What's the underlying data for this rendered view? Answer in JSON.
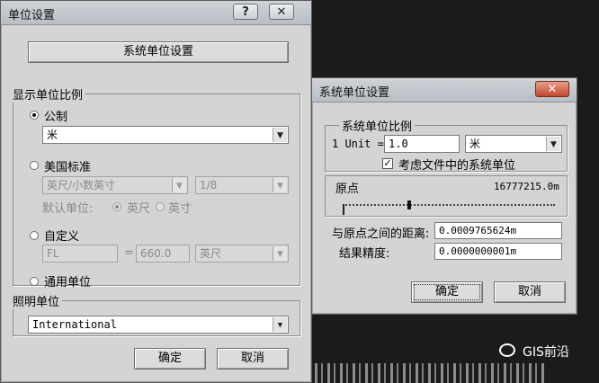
{
  "unit_setup": {
    "title": "单位设置",
    "help_glyph": "?",
    "close_glyph": "✕",
    "system_unit_button": "系统单位设置",
    "display_group_label": "显示单位比例",
    "metric": {
      "label": "公制",
      "selected": true,
      "value": "米"
    },
    "us_standard": {
      "label": "美国标准",
      "selected": false,
      "unit_value": "英尺/小数英寸",
      "fraction_value": "1/8",
      "default_unit_label": "默认单位:",
      "feet_option": "英尺",
      "inches_option": "英寸",
      "default_selected": "英尺"
    },
    "custom": {
      "label": "自定义",
      "selected": false,
      "name_value": "FL",
      "equals": "=",
      "amount_value": "660.0",
      "unit_value": "英尺"
    },
    "generic": {
      "label": "通用单位",
      "selected": false
    },
    "lighting_group_label": "照明单位",
    "lighting_value": "International",
    "ok_label": "确定",
    "cancel_label": "取消"
  },
  "system_unit_setup": {
    "title": "系统单位设置",
    "close_glyph": "✕",
    "scale_group_label": "系统单位比例",
    "unit_prefix": "1 Unit =",
    "unit_amount": "1.0",
    "unit_type": "米",
    "respect_label": "考虑文件中的系统单位",
    "respect_checked": true,
    "origin_label": "原点",
    "origin_value": "16777215.0m",
    "origin_slider_fraction": 0.03,
    "distance_label": "与原点之间的距离:",
    "distance_value": "0.0009765624m",
    "precision_label": "结果精度:",
    "precision_value": "0.0000000001m",
    "ok_label": "确定",
    "cancel_label": "取消"
  },
  "watermark": {
    "text": "GIS前沿"
  }
}
